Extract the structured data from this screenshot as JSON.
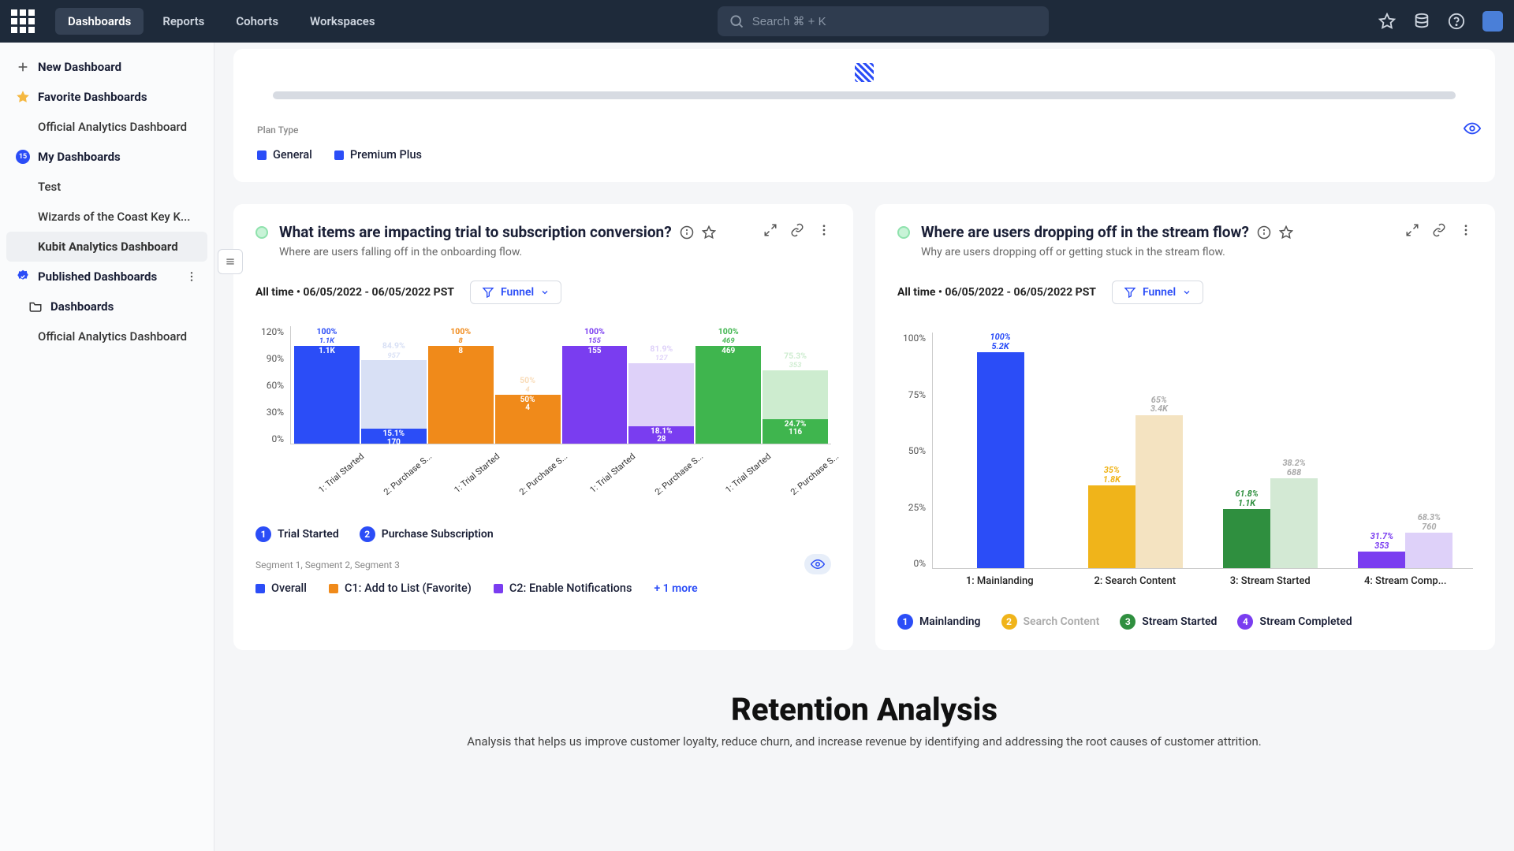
{
  "nav": {
    "tabs": [
      "Dashboards",
      "Reports",
      "Cohorts",
      "Workspaces"
    ],
    "active": "Dashboards",
    "search_placeholder": "Search ⌘ + K"
  },
  "sidebar": {
    "new_dashboard": "New Dashboard",
    "favorite_header": "Favorite Dashboards",
    "favorite_items": [
      "Official Analytics Dashboard"
    ],
    "my_header": "My Dashboards",
    "my_items": [
      "Test",
      "Wizards of the Coast Key K...",
      "Kubit Analytics Dashboard"
    ],
    "my_active": "Kubit Analytics Dashboard",
    "published_header": "Published Dashboards",
    "folder_label": "Dashboards",
    "folder_items": [
      "Official Analytics Dashboard"
    ]
  },
  "top_card": {
    "label": "Plan Type",
    "legend": [
      {
        "label": "General",
        "color": "#2b4df7"
      },
      {
        "label": "Premium Plus",
        "color": "#2b4df7"
      }
    ]
  },
  "panel_left": {
    "title": "What items are impacting trial to subscription conversion?",
    "subtitle": "Where are users falling off in the onboarding flow.",
    "time_label": "All time  •  06/05/2022 - 06/05/2022 PST",
    "funnel_label": "Funnel",
    "segments_label": "Segment 1, Segment 2, Segment 3",
    "steps": [
      {
        "num": "1",
        "label": "Trial Started",
        "color": "#2b4df7"
      },
      {
        "num": "2",
        "label": "Purchase Subscription",
        "color": "#2b4df7"
      }
    ],
    "legend": [
      {
        "label": "Overall",
        "color": "#2b4df7"
      },
      {
        "label": "C1: Add to List (Favorite)",
        "color": "#f08a1a"
      },
      {
        "label": "C2: Enable Notifications",
        "color": "#7a3df0"
      }
    ],
    "more_label": "+ 1 more"
  },
  "panel_right": {
    "title": "Where are users dropping off in the stream flow?",
    "subtitle": "Why are users dropping off or getting stuck in the stream flow.",
    "time_label": "All time  •  06/05/2022 - 06/05/2022 PST",
    "funnel_label": "Funnel",
    "steps": [
      {
        "num": "1",
        "label": "Mainlanding",
        "color": "#2b4df7"
      },
      {
        "num": "2",
        "label": "Search Content",
        "color": "#f0b41a",
        "dim": true
      },
      {
        "num": "3",
        "label": "Stream Started",
        "color": "#2f8f3f"
      },
      {
        "num": "4",
        "label": "Stream Completed",
        "color": "#7a3df0"
      }
    ]
  },
  "section": {
    "title": "Retention Analysis",
    "subtitle": "Analysis that helps us improve customer loyalty, reduce churn, and increase revenue by identifying and addressing the root causes of customer attrition."
  },
  "chart_data": [
    {
      "type": "bar",
      "title": "What items are impacting trial to subscription conversion?",
      "ylabel": "%",
      "ylim": [
        0,
        120
      ],
      "yticks": [
        "120%",
        "90%",
        "60%",
        "30%",
        "0%"
      ],
      "categories": [
        "1: Trial Started",
        "2: Purchase S...",
        "1: Trial Started",
        "2: Purchase S...",
        "1: Trial Started",
        "2: Purchase S...",
        "1: Trial Started",
        "2: Purchase S..."
      ],
      "bars": [
        {
          "pct": "100%",
          "val": "1.1K",
          "h": 100,
          "color": "#2b4df7",
          "pair": 0
        },
        {
          "pct": "84.9%",
          "val": "957",
          "h": 85,
          "color": "#d8e0f5",
          "inner_pct": "15.1%",
          "inner_val": "170",
          "inner_h": 15,
          "inner_color": "#2b4df7",
          "pair": 0
        },
        {
          "pct": "100%",
          "val": "8",
          "h": 100,
          "color": "#f08a1a",
          "pair": 1
        },
        {
          "pct": "50%",
          "val": "4",
          "h": 50,
          "color": "#f9dcb9",
          "inner_pct": "50%",
          "inner_val": "4",
          "inner_h": 50,
          "inner_color": "#f08a1a",
          "pair": 1
        },
        {
          "pct": "100%",
          "val": "155",
          "h": 100,
          "color": "#7a3df0",
          "pair": 2
        },
        {
          "pct": "81.9%",
          "val": "127",
          "h": 82,
          "color": "#ded1f9",
          "inner_pct": "18.1%",
          "inner_val": "28",
          "inner_h": 18,
          "inner_color": "#7a3df0",
          "pair": 2
        },
        {
          "pct": "100%",
          "val": "469",
          "h": 100,
          "color": "#3fb54e",
          "pair": 3
        },
        {
          "pct": "75.3%",
          "val": "353",
          "h": 75,
          "color": "#cdeccf",
          "inner_pct": "24.7%",
          "inner_val": "116",
          "inner_h": 25,
          "inner_color": "#3fb54e",
          "pair": 3
        }
      ]
    },
    {
      "type": "bar",
      "title": "Where are users dropping off in the stream flow?",
      "ylabel": "%",
      "ylim": [
        0,
        100
      ],
      "yticks": [
        "100%",
        "75%",
        "50%",
        "25%",
        "0%"
      ],
      "categories": [
        "1: Mainlanding",
        "2: Search Content",
        "3: Stream Started",
        "4: Stream Comp..."
      ],
      "groups": [
        {
          "pale_pct": null,
          "pale_val": null,
          "pale_h": 0,
          "pale_color": "#f4e3c1",
          "main_pct": "100%",
          "main_val": "5.2K",
          "main_h": 100,
          "main_color": "#2b4df7"
        },
        {
          "pale_pct": "65%",
          "pale_val": "3.4K",
          "pale_h": 65,
          "pale_color": "#f4e3c1",
          "main_pct": "35%",
          "main_val": "1.8K",
          "main_h": 35,
          "main_color": "#f0b41a"
        },
        {
          "pale_pct": "38.2%",
          "pale_val": "688",
          "pale_h": 38,
          "pale_color": "#d3e9d4",
          "main_pct": "61.8%",
          "main_val": "1.1K",
          "main_h": 25,
          "main_color": "#2f8f3f"
        },
        {
          "pale_pct": "68.3%",
          "pale_val": "760",
          "pale_h": 15,
          "pale_color": "#ded1f9",
          "main_pct": "31.7%",
          "main_val": "353",
          "main_h": 7,
          "main_color": "#7a3df0"
        }
      ]
    }
  ]
}
